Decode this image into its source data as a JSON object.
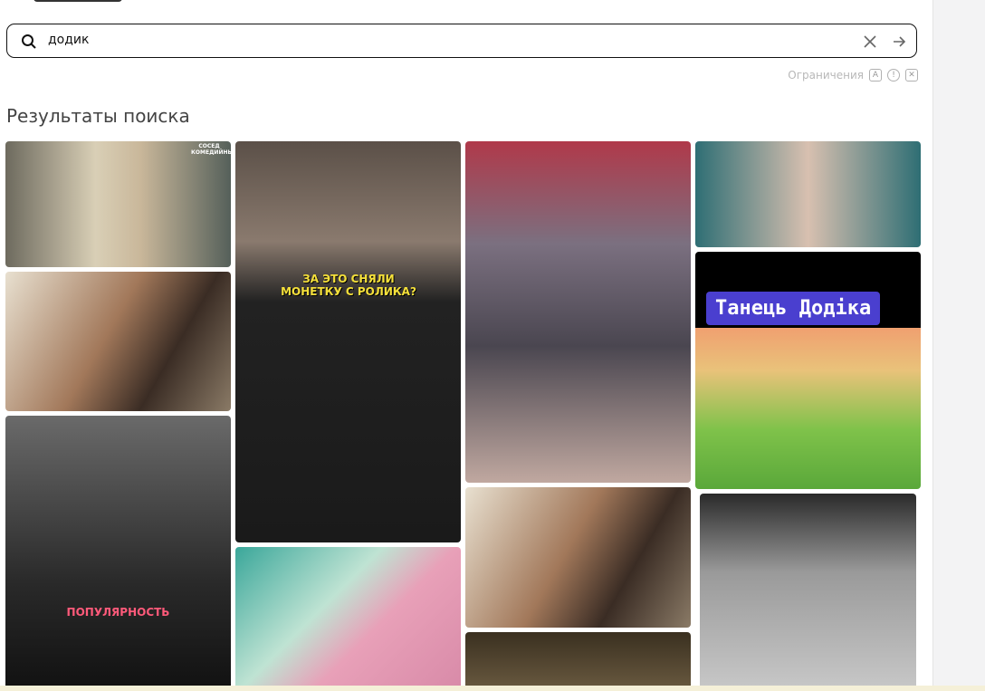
{
  "search": {
    "query": "додик",
    "placeholder": ""
  },
  "limits": {
    "label": "Ограничения",
    "icons": [
      "A",
      "!",
      "✕"
    ]
  },
  "results_title": "Результаты поиска",
  "tiles": {
    "t2_caption": "ЗА ЭТО СНЯЛИ МОНЕТКУ С РОЛИКА?",
    "t_panda_caption": "Танець Додіка",
    "t_pop_caption": "ПОПУЛЯРНОСТЬ",
    "t1_caption": "СОСЕД КОМЕДИЙНЫЙ"
  }
}
